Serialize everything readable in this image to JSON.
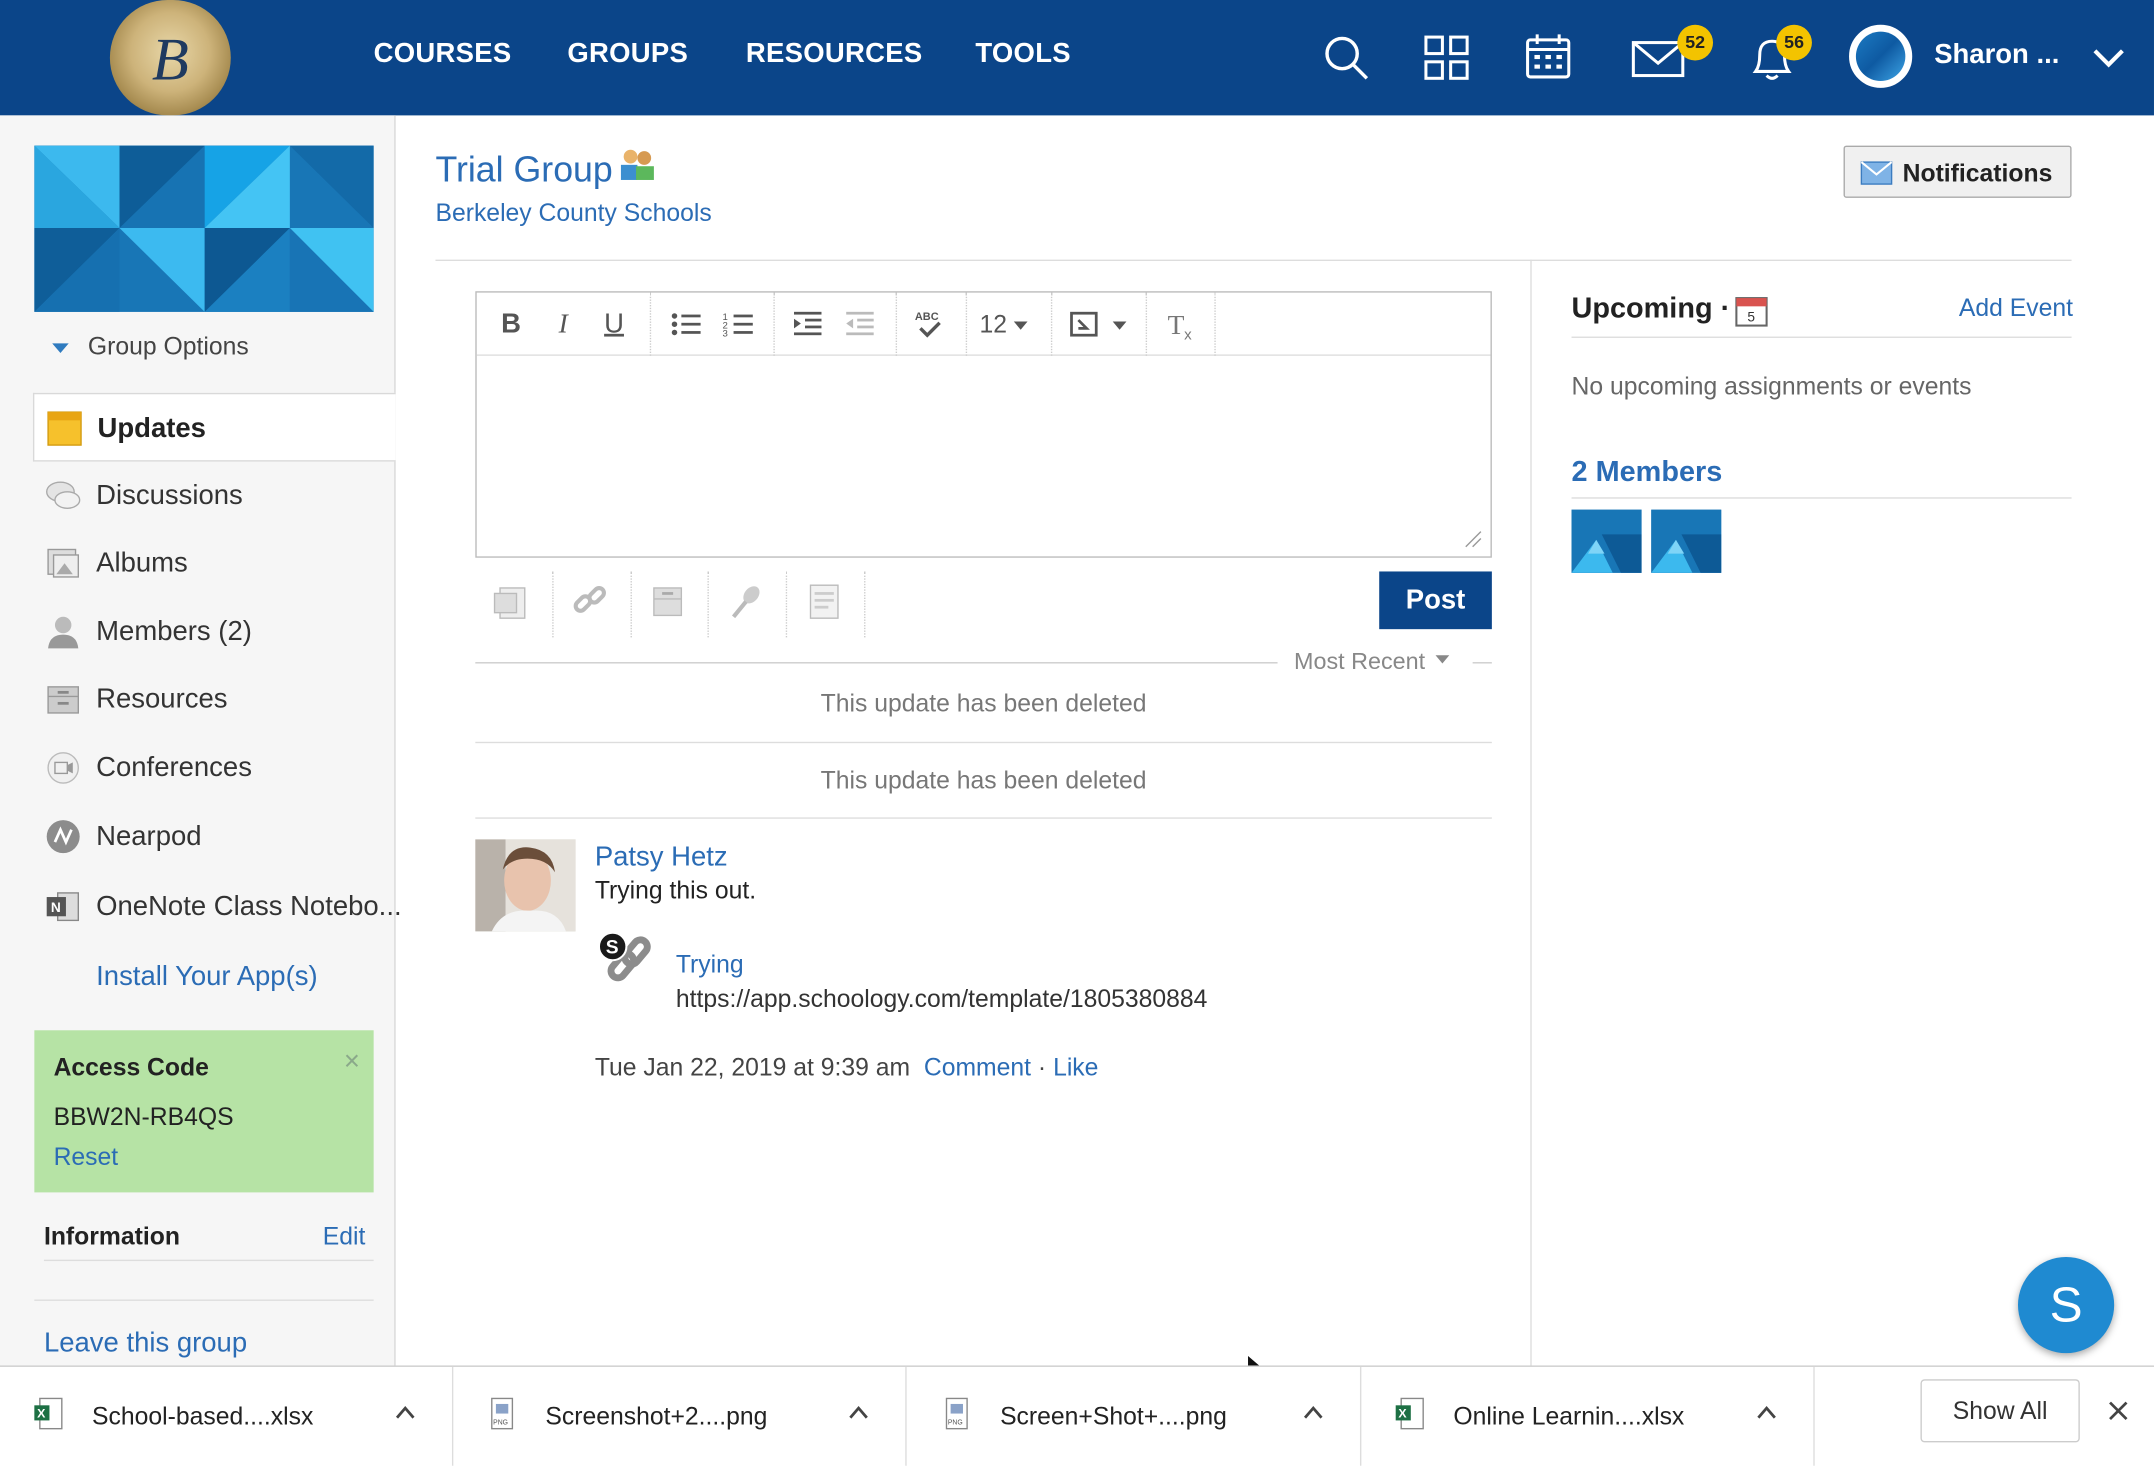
{
  "colors": {
    "nav_bg": "#0b4589",
    "link": "#2b6cb5",
    "badge": "#f3c300",
    "access_bg": "#b6e3a5",
    "post_btn": "#0b4589"
  },
  "topnav": {
    "logo": {
      "icon": "district-seal-logo",
      "initial": "B"
    },
    "items": [
      "COURSES",
      "GROUPS",
      "RESOURCES",
      "TOOLS"
    ],
    "icons": [
      "search-icon",
      "apps-grid-icon",
      "calendar-icon",
      "mail-icon",
      "bell-icon"
    ],
    "mail_badge": "52",
    "bell_badge": "56",
    "user_name": "Sharon ..."
  },
  "sidebar": {
    "group_options": "Group Options",
    "items": [
      {
        "label": "Updates",
        "icon": "updates-icon",
        "active": true
      },
      {
        "label": "Discussions",
        "icon": "discussions-icon"
      },
      {
        "label": "Albums",
        "icon": "albums-icon"
      },
      {
        "label": "Members (2)",
        "icon": "members-icon"
      },
      {
        "label": "Resources",
        "icon": "resources-icon"
      },
      {
        "label": "Conferences",
        "icon": "conferences-icon"
      },
      {
        "label": "Nearpod",
        "icon": "nearpod-icon"
      },
      {
        "label": "OneNote Class Notebo...",
        "icon": "onenote-icon"
      }
    ],
    "install_apps": "Install Your App(s)",
    "access_code": {
      "title": "Access Code",
      "code": "BBW2N-RB4QS",
      "reset": "Reset",
      "close": "×"
    },
    "information": {
      "title": "Information",
      "edit": "Edit"
    },
    "leave": "Leave this group"
  },
  "header": {
    "title": "Trial Group",
    "subtitle": "Berkeley County Schools",
    "notifications_btn": "Notifications"
  },
  "editor": {
    "toolbar": [
      "bold-icon",
      "italic-icon",
      "underline-icon",
      "bulleted-list-icon",
      "numbered-list-icon",
      "indent-icon",
      "outdent-icon",
      "spellcheck-icon",
      "font-size-select",
      "insert-content-icon",
      "clear-format-icon"
    ],
    "font_size": "12",
    "attachments": [
      "file-attach-icon",
      "link-attach-icon",
      "resource-attach-icon",
      "audio-attach-icon",
      "page-attach-icon"
    ],
    "post_label": "Post"
  },
  "feed": {
    "sort": "Most Recent",
    "deleted_notices": [
      "This update has been deleted",
      "This update has been deleted"
    ],
    "post": {
      "author": "Patsy Hetz",
      "body": "Trying this out.",
      "link_title": "Trying",
      "link_url": "https://app.schoology.com/template/1805380884",
      "timestamp": "Tue Jan 22, 2019 at 9:39 am",
      "comment": "Comment",
      "dot": "·",
      "like": "Like"
    }
  },
  "right": {
    "upcoming": "Upcoming ·",
    "calendar_day": "5",
    "add_event": "Add Event",
    "no_upcoming": "No upcoming assignments or events",
    "members_title": "2 Members"
  },
  "chat": {
    "label": "S"
  },
  "downloads": {
    "files": [
      {
        "name": "School-based....xlsx",
        "type": "xlsx"
      },
      {
        "name": "Screenshot+2....png",
        "type": "png"
      },
      {
        "name": "Screen+Shot+....png",
        "type": "png"
      },
      {
        "name": "Online Learnin....xlsx",
        "type": "xlsx"
      }
    ],
    "show_all": "Show All"
  }
}
